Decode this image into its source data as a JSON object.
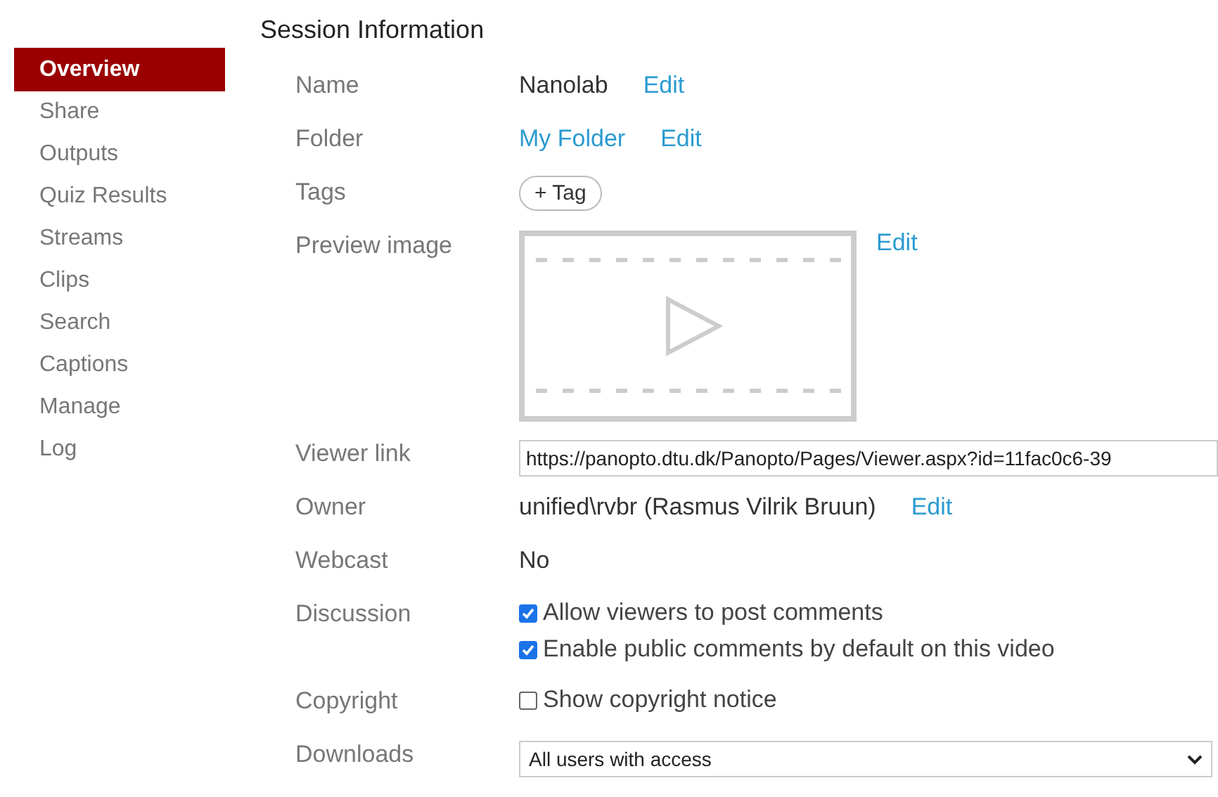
{
  "sidebar": {
    "items": [
      {
        "label": "Overview",
        "selected": true
      },
      {
        "label": "Share",
        "selected": false
      },
      {
        "label": "Outputs",
        "selected": false
      },
      {
        "label": "Quiz Results",
        "selected": false
      },
      {
        "label": "Streams",
        "selected": false
      },
      {
        "label": "Clips",
        "selected": false
      },
      {
        "label": "Search",
        "selected": false
      },
      {
        "label": "Captions",
        "selected": false
      },
      {
        "label": "Manage",
        "selected": false
      },
      {
        "label": "Log",
        "selected": false
      }
    ]
  },
  "section": {
    "title": "Session Information",
    "rows": [
      {
        "kind": "text",
        "label": "Name",
        "value": "Nanolab",
        "edit": "Edit"
      },
      {
        "kind": "link",
        "label": "Folder",
        "value": "My Folder",
        "edit": "Edit"
      },
      {
        "kind": "tag",
        "label": "Tags",
        "value": "+ Tag"
      },
      {
        "kind": "preview",
        "label": "Preview image",
        "edit": "Edit"
      },
      {
        "kind": "input",
        "label": "Viewer link",
        "value": "https://panopto.dtu.dk/Panopto/Pages/Viewer.aspx?id=11fac0c6-39"
      },
      {
        "kind": "text",
        "label": "Owner",
        "value": "unified\\rvbr (Rasmus Vilrik Bruun)",
        "edit": "Edit"
      },
      {
        "kind": "text",
        "label": "Webcast",
        "value": "No"
      },
      {
        "kind": "checks",
        "label": "Discussion",
        "options": [
          {
            "label": "Allow viewers to post comments",
            "checked": true
          },
          {
            "label": "Enable public comments by default on this video",
            "checked": true
          }
        ]
      },
      {
        "kind": "checks",
        "label": "Copyright",
        "options": [
          {
            "label": "Show copyright notice",
            "checked": false
          }
        ]
      },
      {
        "kind": "select",
        "label": "Downloads",
        "value": "All users with access"
      }
    ]
  }
}
